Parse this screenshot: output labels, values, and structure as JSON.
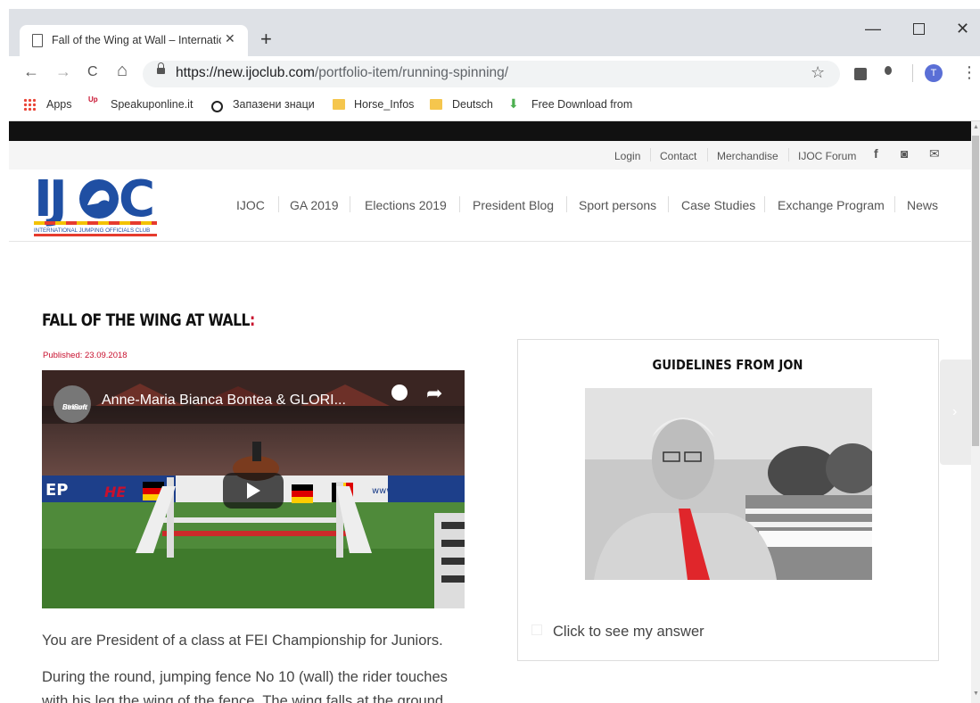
{
  "browser": {
    "tab_title": "Fall of the Wing at Wall – International",
    "tab_close": "✕",
    "new_tab": "+",
    "window_controls": {
      "minimize": "—",
      "maximize": "",
      "close": "✕"
    },
    "nav": {
      "back": "←",
      "forward": "→",
      "reload": "C",
      "home": "⌂"
    },
    "url_host": "https://new.ijoclub.com",
    "url_path": "/portfolio-item/running-spinning/",
    "star": "☆",
    "avatar_letter": "T",
    "menu": "⋮",
    "bookmarks": [
      {
        "label": "Apps"
      },
      {
        "label": "Speakuponline.it",
        "badge": "Up"
      },
      {
        "label": "Запазени знаци"
      },
      {
        "label": "Horse_Infos"
      },
      {
        "label": "Deutsch"
      },
      {
        "label": "Free Download from"
      }
    ]
  },
  "site": {
    "top_links": [
      "Login",
      "Contact",
      "Merchandise",
      "IJOC Forum"
    ],
    "social": {
      "facebook": "f",
      "instagram": "◙",
      "mail": "✉"
    },
    "logo_tagline": "INTERNATIONAL JUMPING OFFICIALS CLUB",
    "nav": [
      "IJOC",
      "GA 2019",
      "Elections 2019",
      "President Blog",
      "Sport persons",
      "Case Studies",
      "Exchange Program",
      "News"
    ]
  },
  "post": {
    "title": "FALL OF THE WING AT WALL",
    "title_colon": ":",
    "published": "Published: 23.09.2018",
    "video": {
      "title": "Anne-Maria Bianca Bontea & GLORI...",
      "channel": "BelSoft Stream",
      "channel_line1": "BelSoft",
      "channel_line2": "Stream",
      "board_left": "EP",
      "board_mid": "HE",
      "board_right": "www"
    },
    "paragraphs": [
      "You are President of a class at FEI Championship for Juniors.",
      "During the round, jumping fence No 10 (wall) the rider touches",
      "with his leg the wing of the fence. The wing falls at the ground."
    ]
  },
  "sidebar": {
    "title": "GUIDELINES FROM JON",
    "answer_label": "Click to see my answer",
    "next_arrow": "›"
  }
}
